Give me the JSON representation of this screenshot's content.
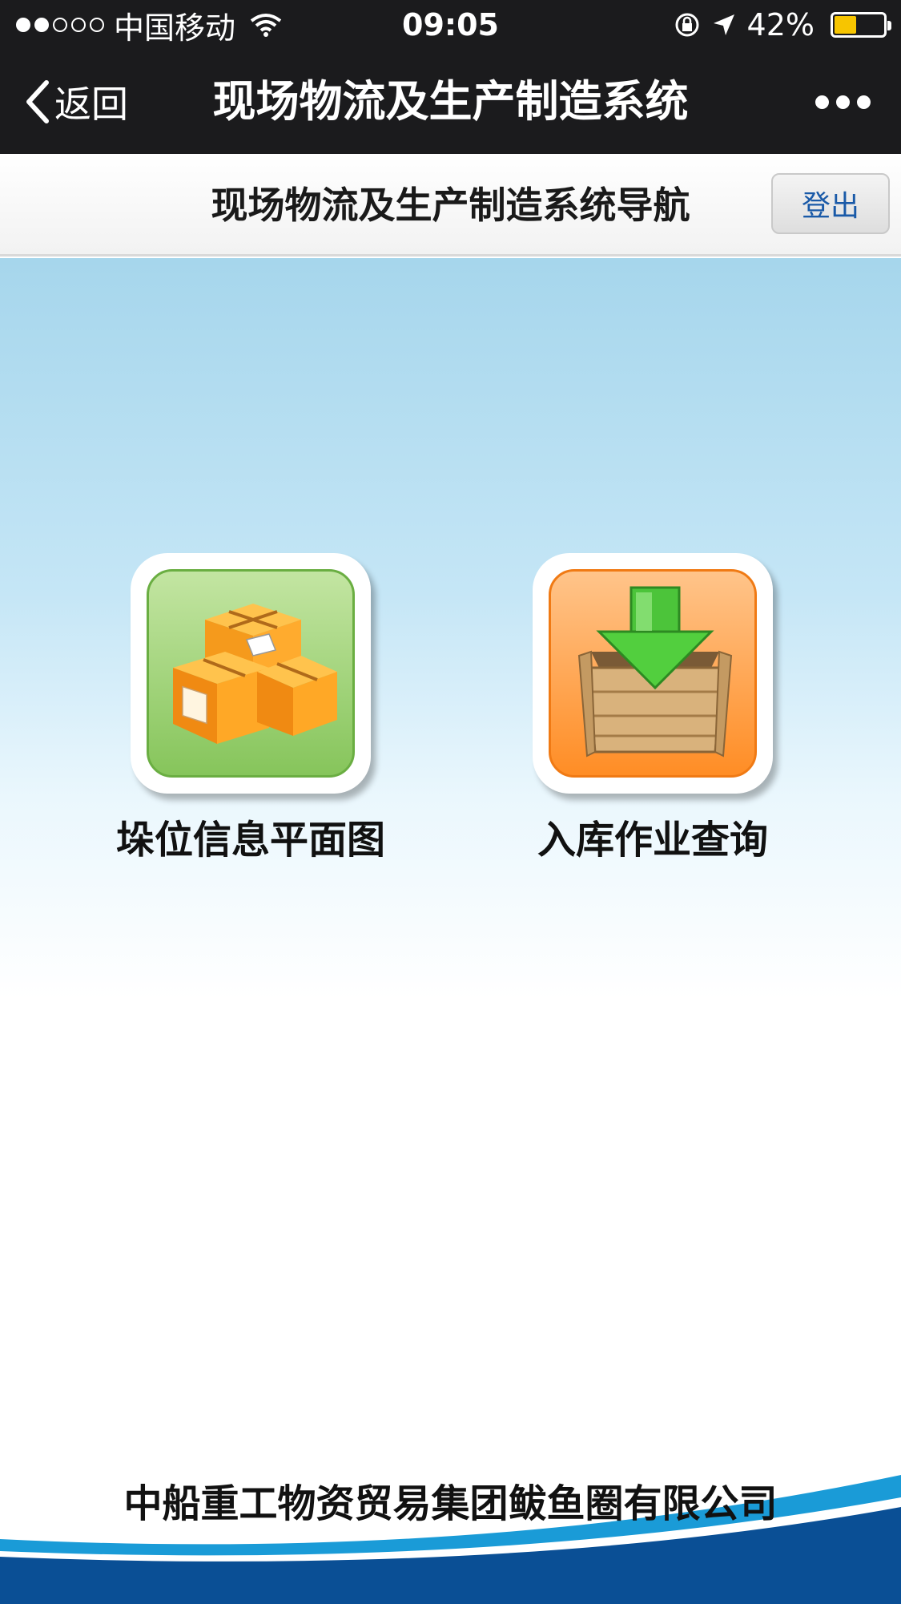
{
  "status_bar": {
    "signal_dots": [
      true,
      true,
      false,
      false,
      false
    ],
    "carrier": "中国移动",
    "time": "09:05",
    "battery_text": "42%",
    "battery_level": 0.42
  },
  "nav": {
    "back_label": "返回",
    "title": "现场物流及生产制造系统"
  },
  "header": {
    "title": "现场物流及生产制造系统导航",
    "logout_label": "登出"
  },
  "tiles": [
    {
      "label": "垛位信息平面图",
      "icon": "boxes-icon"
    },
    {
      "label": "入库作业查询",
      "icon": "inbound-crate-icon"
    }
  ],
  "footer": {
    "company": "中船重工物资贸易集团鲅鱼圈有限公司"
  },
  "colors": {
    "bar_bg": "#1b1b1d",
    "sky_top": "#a6d6ec",
    "footer_blue": "#0a4f95",
    "footer_light_blue": "#1a9bd7"
  }
}
